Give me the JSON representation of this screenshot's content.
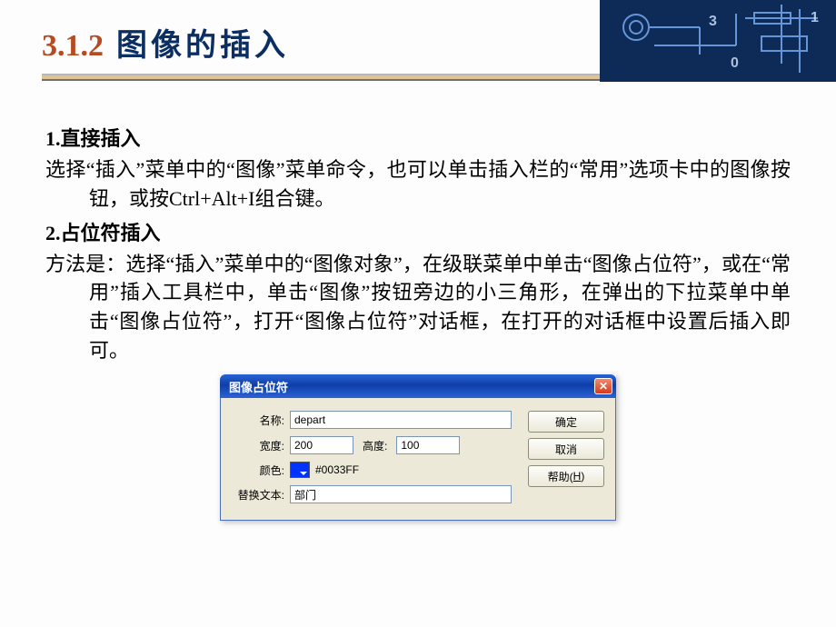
{
  "section": {
    "number": "3.1.2",
    "title": "图像的插入"
  },
  "content": {
    "h1": "1.直接插入",
    "p1": "选择“插入”菜单中的“图像”菜单命令，也可以单击插入栏的“常用”选项卡中的图像按钮，或按Ctrl+Alt+I组合键。",
    "h2": "2.占位符插入",
    "p2": "方法是：选择“插入”菜单中的“图像对象”，在级联菜单中单击“图像占位符”，或在“常用”插入工具栏中，单击“图像”按钮旁边的小三角形，在弹出的下拉菜单中单击“图像占位符”，打开“图像占位符”对话框，在打开的对话框中设置后插入即可。"
  },
  "dialog": {
    "title": "图像占位符",
    "labels": {
      "name": "名称:",
      "width": "宽度:",
      "height": "高度:",
      "color": "颜色:",
      "alt": "替换文本:"
    },
    "values": {
      "name": "depart",
      "width": "200",
      "height": "100",
      "colorHex": "#0033FF",
      "alt": "部门"
    },
    "colors": {
      "swatch": "#0033ff"
    },
    "buttons": {
      "ok": "确定",
      "cancel": "取消",
      "help_prefix": "帮助(",
      "help_key": "H",
      "help_suffix": ")"
    }
  }
}
